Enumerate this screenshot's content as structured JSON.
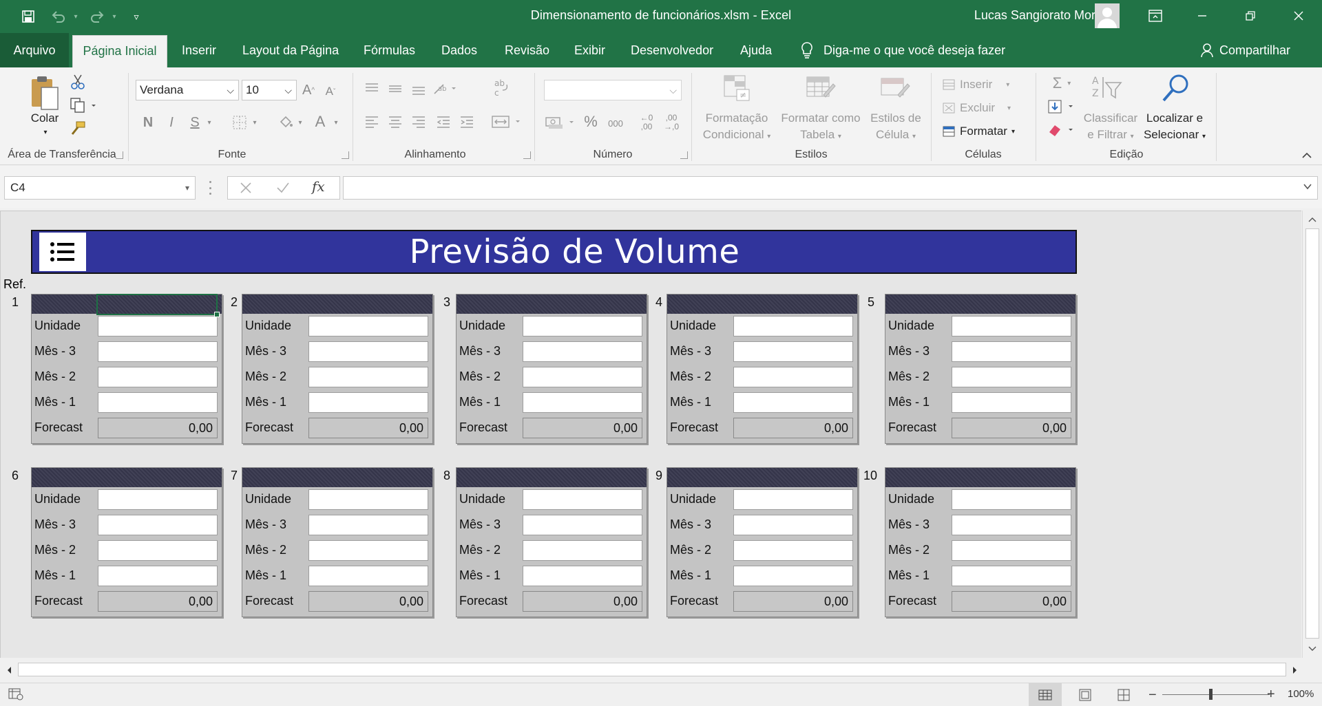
{
  "window": {
    "title": "Dimensionamento de funcionários.xlsm  -  Excel",
    "user": "Lucas Sangiorato Moraes"
  },
  "tabs": [
    "Arquivo",
    "Página Inicial",
    "Inserir",
    "Layout da Página",
    "Fórmulas",
    "Dados",
    "Revisão",
    "Exibir",
    "Desenvolvedor",
    "Ajuda"
  ],
  "tell_me": "Diga-me o que você deseja fazer",
  "share": "Compartilhar",
  "ribbon": {
    "clipboard": {
      "paste": "Colar",
      "label": "Área de Transferência"
    },
    "font": {
      "name": "Verdana",
      "size": "10",
      "bold": "N",
      "italic": "I",
      "underline": "S",
      "label": "Fonte"
    },
    "alignment": {
      "label": "Alinhamento"
    },
    "number": {
      "label": "Número",
      "percent": "%",
      "thousands": "000",
      "inc_dec": "←0\n,00",
      "dec_dec": ",00\n→,0"
    },
    "styles": {
      "conditional": [
        "Formatação",
        "Condicional"
      ],
      "as_table": [
        "Formatar como",
        "Tabela"
      ],
      "cell_styles": [
        "Estilos de",
        "Célula"
      ],
      "label": "Estilos"
    },
    "cells": {
      "insert": "Inserir",
      "delete": "Excluir",
      "format": "Formatar",
      "label": "Células"
    },
    "editing": {
      "sort": [
        "Classificar",
        "e Filtrar"
      ],
      "find": [
        "Localizar e",
        "Selecionar"
      ],
      "label": "Edição"
    }
  },
  "formula_bar": {
    "name_box": "C4",
    "fx": "fx",
    "value": ""
  },
  "sheet": {
    "banner_title": "Previsão de Volume",
    "ref_label": "Ref.",
    "row_labels": [
      "Unidade",
      "Mês - 3",
      "Mês - 2",
      "Mês - 1",
      "Forecast"
    ],
    "cards": [
      {
        "num": "1",
        "forecast": "0,00"
      },
      {
        "num": "2",
        "forecast": "0,00"
      },
      {
        "num": "3",
        "forecast": "0,00"
      },
      {
        "num": "4",
        "forecast": "0,00"
      },
      {
        "num": "5",
        "forecast": "0,00"
      },
      {
        "num": "6",
        "forecast": "0,00"
      },
      {
        "num": "7",
        "forecast": "0,00"
      },
      {
        "num": "8",
        "forecast": "0,00"
      },
      {
        "num": "9",
        "forecast": "0,00"
      },
      {
        "num": "10",
        "forecast": "0,00"
      }
    ]
  },
  "status": {
    "zoom": "100%"
  },
  "colors": {
    "excel_green": "#217346",
    "banner": "#31349c",
    "card_header": "#3a3a50"
  }
}
